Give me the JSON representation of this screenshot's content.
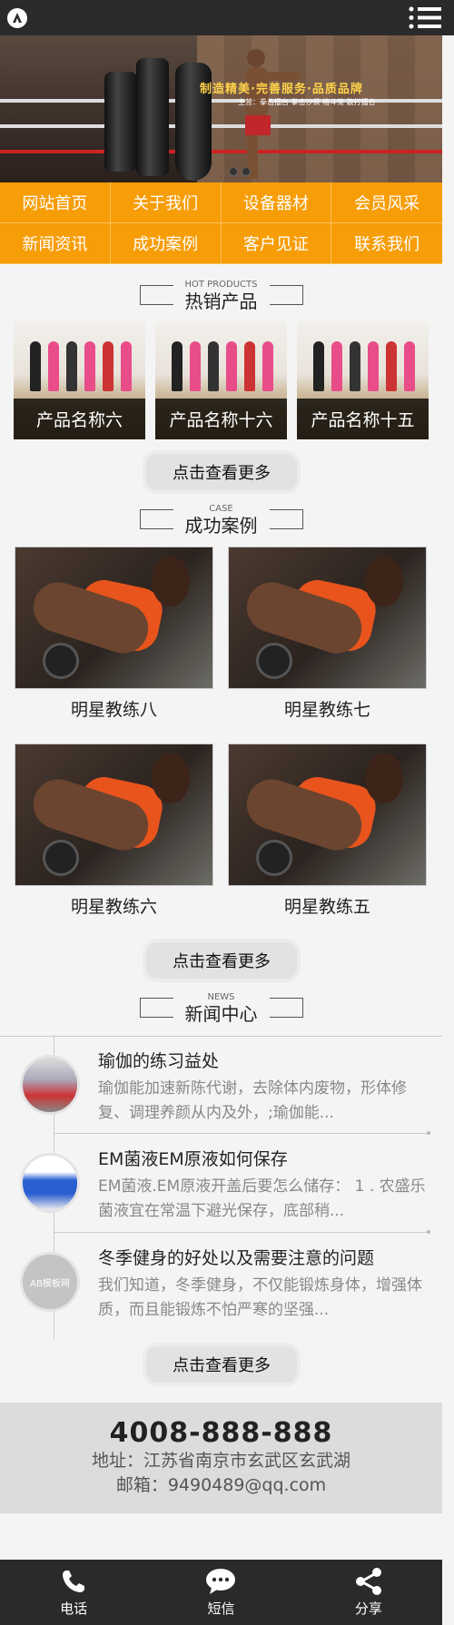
{
  "banner": {
    "slogan": "制造精美·完善服务·品质品牌",
    "sub": "主营：拳击擂台   拳击沙袋   格斗笼 散打擂台"
  },
  "nav": [
    {
      "label": "网站首页"
    },
    {
      "label": "关于我们"
    },
    {
      "label": "设备器材"
    },
    {
      "label": "会员风采"
    },
    {
      "label": "新闻资讯"
    },
    {
      "label": "成功案例"
    },
    {
      "label": "客户见证"
    },
    {
      "label": "联系我们"
    }
  ],
  "hot": {
    "en": "HOT PRODUCTS",
    "cn": "热销产品",
    "items": [
      {
        "name": "产品名称六"
      },
      {
        "name": "产品名称十六"
      },
      {
        "name": "产品名称十五"
      }
    ],
    "more": "点击查看更多"
  },
  "cases": {
    "en": "CASE",
    "cn": "成功案例",
    "items": [
      {
        "name": "明星教练八"
      },
      {
        "name": "明星教练七"
      },
      {
        "name": "明星教练六"
      },
      {
        "name": "明星教练五"
      }
    ],
    "more": "点击查看更多"
  },
  "news": {
    "en": "NEWS",
    "cn": "新闻中心",
    "items": [
      {
        "title": "瑜伽的练习益处",
        "desc": "瑜伽能加速新陈代谢，去除体内废物，形体修复、调理养颜从内及外，;瑜伽能..."
      },
      {
        "title": "EM菌液EM原液如何保存",
        "desc": "EM菌液.EM原液开盖后要怎么储存： 1 . 农盛乐菌液宜在常温下避光保存，底部稍..."
      },
      {
        "title": "冬季健身的好处以及需要注意的问题",
        "desc": "我们知道，冬季健身，不仅能锻炼身体，增强体质，而且能锻炼不怕严寒的坚强..."
      }
    ],
    "thumb3_text": "AB模板网",
    "more": "点击查看更多"
  },
  "contact": {
    "phone": "4008-888-888",
    "address": "地址：江苏省南京市玄武区玄武湖",
    "email": "邮箱：9490489@qq.com"
  },
  "bottom": {
    "call": "电话",
    "sms": "短信",
    "share": "分享"
  },
  "colors": {
    "accent": "#f79d07",
    "dark": "#2a2a2a"
  }
}
